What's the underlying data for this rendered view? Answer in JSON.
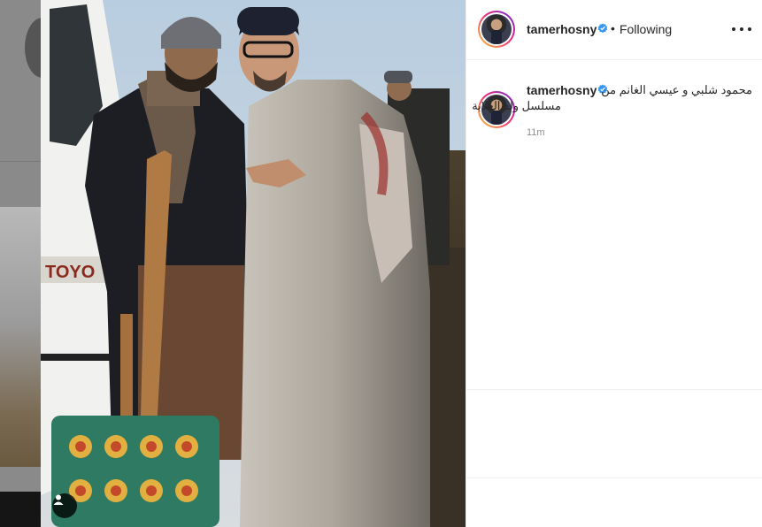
{
  "post": {
    "username": "tamerhosny",
    "follow_status": "Following",
    "separator": "•",
    "caption_line1": "محمود شلبي و عيسي الغانم من",
    "caption_line2": "مسلسل ولد الغلابة",
    "time_ago": "11m"
  },
  "icons": {
    "verified": "verified-badge-icon",
    "more": "more-options-icon",
    "user_tag": "user-tag-icon"
  },
  "colors": {
    "verified_blue": "#3897f0",
    "text": "#262626",
    "muted": "#8e8e8e",
    "story_ring": "#ee2a7b"
  }
}
